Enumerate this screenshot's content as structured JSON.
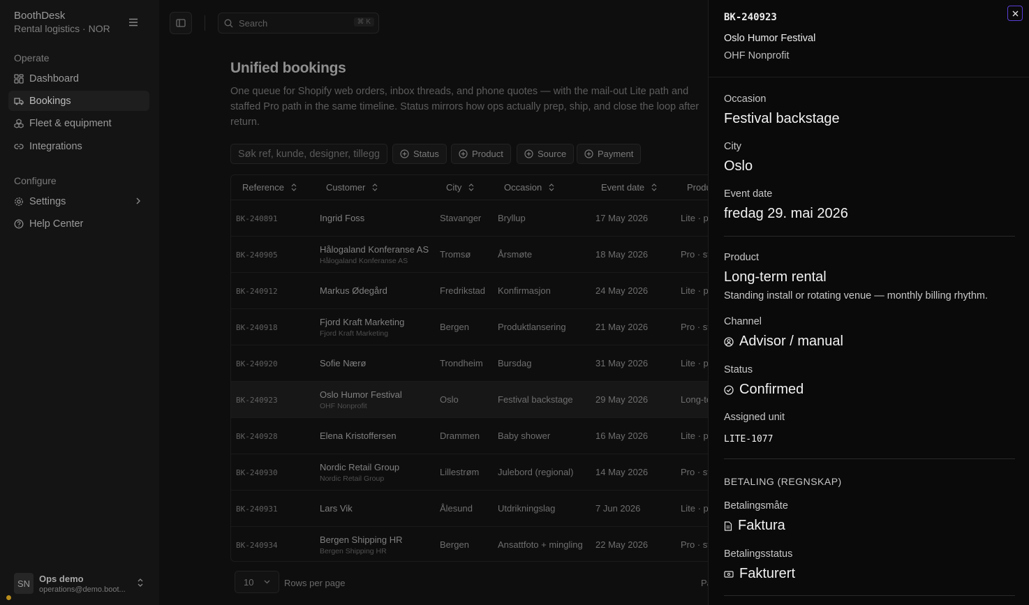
{
  "app": {
    "name": "BoothDesk",
    "subtitle": "Rental logistics · NOR"
  },
  "sidebar": {
    "sections": [
      {
        "label": "Operate",
        "items": [
          {
            "label": "Dashboard",
            "icon": "dashboard-icon",
            "active": false
          },
          {
            "label": "Bookings",
            "icon": "truck-icon",
            "active": true
          },
          {
            "label": "Fleet & equipment",
            "icon": "boxes-icon",
            "active": false
          },
          {
            "label": "Integrations",
            "icon": "link-icon",
            "active": false
          }
        ]
      },
      {
        "label": "Configure",
        "items": [
          {
            "label": "Settings",
            "icon": "gear-icon",
            "active": false
          },
          {
            "label": "Help Center",
            "icon": "help-icon",
            "active": false
          }
        ]
      }
    ],
    "user": {
      "initials": "SN",
      "name": "Ops demo",
      "email": "operations@demo.boot..."
    }
  },
  "search": {
    "placeholder": "Search",
    "shortcut": "⌘ K"
  },
  "page": {
    "title": "Unified bookings",
    "description": "One queue for Shopify web orders, inbox threads, and phone quotes — with the mail-out Lite path and staffed Pro path in the same timeline. Status mirrors how ops actually prep, ship, and close the loop after return."
  },
  "filters": {
    "search_placeholder": "Søk ref, kunde, designer, tillegg",
    "chips": [
      "Status",
      "Product",
      "Source",
      "Payment"
    ]
  },
  "table": {
    "columns": [
      "Reference",
      "Customer",
      "City",
      "Occasion",
      "Event date",
      "Produ"
    ],
    "rows": [
      {
        "ref": "BK-240891",
        "customer": "Ingrid Foss",
        "org": "",
        "city": "Stavanger",
        "occasion": "Bryllup",
        "date": "17 May 2026",
        "product": "Lite · p"
      },
      {
        "ref": "BK-240905",
        "customer": "Hålogaland Konferanse AS",
        "org": "Hålogaland Konferanse AS",
        "city": "Tromsø",
        "occasion": "Årsmøte",
        "date": "18 May 2026",
        "product": "Pro · st"
      },
      {
        "ref": "BK-240912",
        "customer": "Markus Ødegård",
        "org": "",
        "city": "Fredrikstad",
        "occasion": "Konfirmasjon",
        "date": "24 May 2026",
        "product": "Lite · p"
      },
      {
        "ref": "BK-240918",
        "customer": "Fjord Kraft Marketing",
        "org": "Fjord Kraft Marketing",
        "city": "Bergen",
        "occasion": "Produktlansering",
        "date": "21 May 2026",
        "product": "Pro · st"
      },
      {
        "ref": "BK-240920",
        "customer": "Sofie Nærø",
        "org": "",
        "city": "Trondheim",
        "occasion": "Bursdag",
        "date": "31 May 2026",
        "product": "Lite · p"
      },
      {
        "ref": "BK-240923",
        "customer": "Oslo Humor Festival",
        "org": "OHF Nonprofit",
        "city": "Oslo",
        "occasion": "Festival backstage",
        "date": "29 May 2026",
        "product": "Long-te",
        "selected": true
      },
      {
        "ref": "BK-240928",
        "customer": "Elena Kristoffersen",
        "org": "",
        "city": "Drammen",
        "occasion": "Baby shower",
        "date": "16 May 2026",
        "product": "Lite · p"
      },
      {
        "ref": "BK-240930",
        "customer": "Nordic Retail Group",
        "org": "Nordic Retail Group",
        "city": "Lillestrøm",
        "occasion": "Julebord (regional)",
        "date": "14 May 2026",
        "product": "Pro · st"
      },
      {
        "ref": "BK-240931",
        "customer": "Lars Vik",
        "org": "",
        "city": "Ålesund",
        "occasion": "Utdrikningslag",
        "date": "7 Jun 2026",
        "product": "Lite · p"
      },
      {
        "ref": "BK-240934",
        "customer": "Bergen Shipping HR",
        "org": "Bergen Shipping HR",
        "city": "Bergen",
        "occasion": "Ansattfoto + mingling",
        "date": "22 May 2026",
        "product": "Pro · st"
      }
    ]
  },
  "pagination": {
    "rows_per_page_value": "10",
    "rows_per_page_label": "Rows per page",
    "page_label_truncated": "Pa"
  },
  "detail": {
    "ref": "BK-240923",
    "name": "Oslo Humor Festival",
    "org": "OHF Nonprofit",
    "occasion_label": "Occasion",
    "occasion": "Festival backstage",
    "city_label": "City",
    "city": "Oslo",
    "event_date_label": "Event date",
    "event_date": "fredag 29. mai 2026",
    "product_label": "Product",
    "product": "Long-term rental",
    "product_desc": "Standing install or rotating venue — monthly billing rhythm.",
    "channel_label": "Channel",
    "channel": "Advisor / manual",
    "status_label": "Status",
    "status": "Confirmed",
    "unit_label": "Assigned unit",
    "unit": "LITE-1077",
    "payment_section": "BETALING (REGNSKAP)",
    "payment_method_label": "Betalingsmåte",
    "payment_method": "Faktura",
    "payment_status_label": "Betalingsstatus",
    "payment_status": "Fakturert"
  }
}
